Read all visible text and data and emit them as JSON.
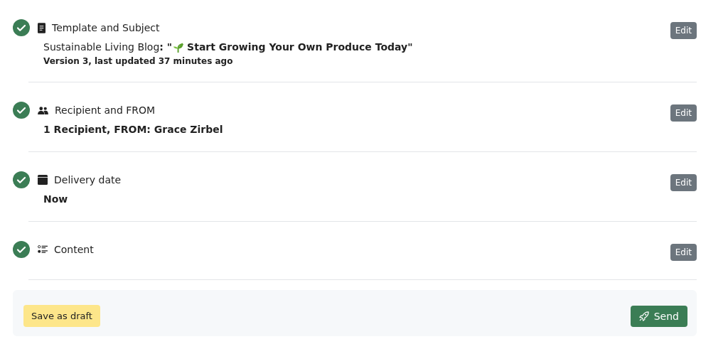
{
  "steps": [
    {
      "title": "Template and Subject",
      "done": true,
      "subject": {
        "prefix": "Sustainable Living Blog**: \"**",
        "title": "Start Growing Your Own Produce Today\""
      },
      "meta": "Version 3, last updated 37 minutes ago",
      "edit": "Edit"
    },
    {
      "title": "Recipient and FROM",
      "done": true,
      "detail": "1 Recipient, FROM: Grace Zirbel",
      "edit": "Edit"
    },
    {
      "title": "Delivery date",
      "done": true,
      "detail": "Now",
      "edit": "Edit"
    },
    {
      "title": "Content",
      "done": true,
      "edit": "Edit"
    }
  ],
  "footer": {
    "draft": "Save as draft",
    "send": "Send"
  }
}
